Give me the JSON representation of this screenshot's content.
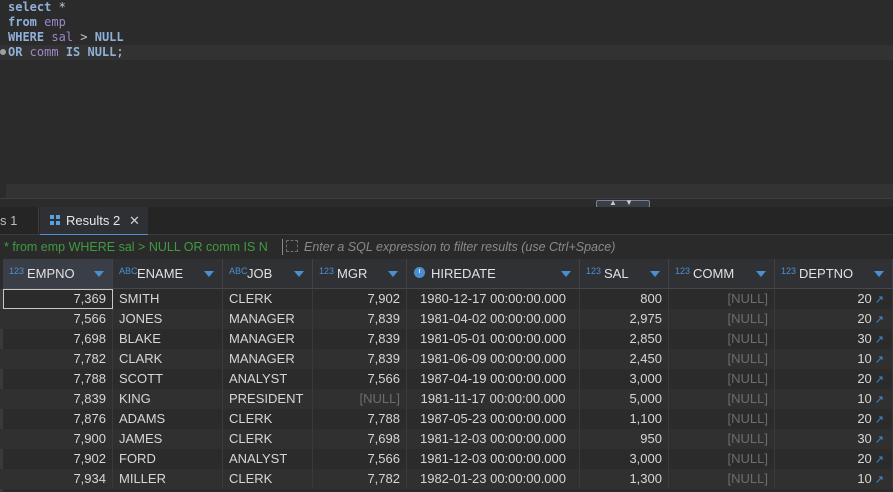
{
  "editor": {
    "lines": [
      [
        {
          "t": "select",
          "c": "kw"
        },
        {
          "t": " *",
          "c": "plain"
        }
      ],
      [
        {
          "t": "from",
          "c": "kw"
        },
        {
          "t": " emp",
          "c": "col"
        }
      ],
      [
        {
          "t": "WHERE",
          "c": "kw"
        },
        {
          "t": " sal",
          "c": "col"
        },
        {
          "t": " > ",
          "c": "plain"
        },
        {
          "t": "NULL",
          "c": "kw"
        }
      ],
      [
        {
          "t": "OR",
          "c": "kw"
        },
        {
          "t": " comm",
          "c": "col"
        },
        {
          "t": " ",
          "c": "plain"
        },
        {
          "t": "IS NULL",
          "c": "kw"
        },
        {
          "t": ";",
          "c": "plain"
        }
      ]
    ]
  },
  "tabs": {
    "previous_label": "s 1",
    "active_label": "Results 2",
    "close_glyph": "✕"
  },
  "filter": {
    "query_text": "* from emp WHERE sal > NULL OR comm IS N",
    "placeholder": "Enter a SQL expression to filter results (use Ctrl+Space)"
  },
  "grid": {
    "columns": [
      {
        "name": "EMPNO",
        "type": "123",
        "align": "num"
      },
      {
        "name": "ENAME",
        "type": "ABC",
        "align": "text"
      },
      {
        "name": "JOB",
        "type": "ABC",
        "align": "text"
      },
      {
        "name": "MGR",
        "type": "123",
        "align": "num"
      },
      {
        "name": "HIREDATE",
        "type": "clock",
        "align": "num"
      },
      {
        "name": "SAL",
        "type": "123",
        "align": "num"
      },
      {
        "name": "COMM",
        "type": "123",
        "align": "num"
      },
      {
        "name": "DEPTNO",
        "type": "123",
        "align": "num"
      }
    ],
    "null_text": "[NULL]",
    "rows": [
      [
        "7,369",
        "SMITH",
        "CLERK",
        "7,902",
        "1980-12-17 00:00:00.000",
        "800",
        "[NULL]",
        "20"
      ],
      [
        "7,566",
        "JONES",
        "MANAGER",
        "7,839",
        "1981-04-02 00:00:00.000",
        "2,975",
        "[NULL]",
        "20"
      ],
      [
        "7,698",
        "BLAKE",
        "MANAGER",
        "7,839",
        "1981-05-01 00:00:00.000",
        "2,850",
        "[NULL]",
        "30"
      ],
      [
        "7,782",
        "CLARK",
        "MANAGER",
        "7,839",
        "1981-06-09 00:00:00.000",
        "2,450",
        "[NULL]",
        "10"
      ],
      [
        "7,788",
        "SCOTT",
        "ANALYST",
        "7,566",
        "1987-04-19 00:00:00.000",
        "3,000",
        "[NULL]",
        "20"
      ],
      [
        "7,839",
        "KING",
        "PRESIDENT",
        "[NULL]",
        "1981-11-17 00:00:00.000",
        "5,000",
        "[NULL]",
        "10"
      ],
      [
        "7,876",
        "ADAMS",
        "CLERK",
        "7,788",
        "1987-05-23 00:00:00.000",
        "1,100",
        "[NULL]",
        "20"
      ],
      [
        "7,900",
        "JAMES",
        "CLERK",
        "7,698",
        "1981-12-03 00:00:00.000",
        "950",
        "[NULL]",
        "30"
      ],
      [
        "7,902",
        "FORD",
        "ANALYST",
        "7,566",
        "1981-12-03 00:00:00.000",
        "3,000",
        "[NULL]",
        "20"
      ],
      [
        "7,934",
        "MILLER",
        "CLERK",
        "7,782",
        "1982-01-23 00:00:00.000",
        "1,300",
        "[NULL]",
        "10"
      ]
    ]
  }
}
